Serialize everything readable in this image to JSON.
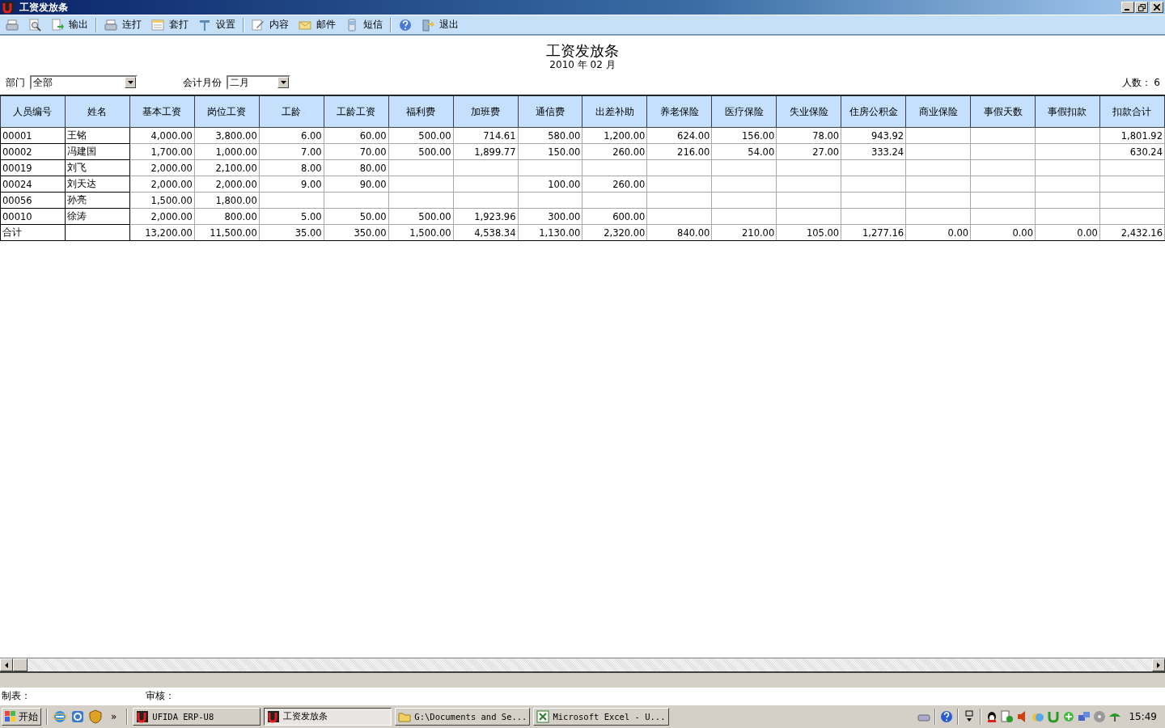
{
  "window": {
    "title": "工资发放条"
  },
  "toolbar": [
    {
      "kind": "button"
    },
    {
      "kind": "button"
    },
    {
      "kind": "button",
      "label": "输出"
    },
    {
      "kind": "separator"
    },
    {
      "kind": "button",
      "label": "连打"
    },
    {
      "kind": "button",
      "label": "套打"
    },
    {
      "kind": "button",
      "label": "设置"
    },
    {
      "kind": "separator"
    },
    {
      "kind": "button",
      "label": "内容"
    },
    {
      "kind": "button",
      "label": "邮件"
    },
    {
      "kind": "button",
      "label": "短信"
    },
    {
      "kind": "separator"
    },
    {
      "kind": "button"
    },
    {
      "kind": "button",
      "label": "退出"
    }
  ],
  "report": {
    "title": "工资发放条",
    "subtitle": "2010 年 02 月"
  },
  "filters": [
    {
      "label": "部门",
      "value": "全部"
    },
    {
      "label": "会计月份",
      "value": "二月"
    }
  ],
  "headcount": "人数： 6",
  "table": {
    "columns": [
      "人员编号",
      "姓名",
      "基本工资",
      "岗位工资",
      "工龄",
      "工龄工资",
      "福利费",
      "加班费",
      "通信费",
      "出差补助",
      "养老保险",
      "医疗保险",
      "失业保险",
      "住房公积金",
      "商业保险",
      "事假天数",
      "事假扣款",
      "扣款合计"
    ],
    "rows": [
      {
        "cells": [
          "00001",
          "王铭",
          "4,000.00",
          "3,800.00",
          "6.00",
          "60.00",
          "500.00",
          "714.61",
          "580.00",
          "1,200.00",
          "624.00",
          "156.00",
          "78.00",
          "943.92",
          null,
          null,
          null,
          "1,801.92"
        ]
      },
      {
        "cells": [
          "00002",
          "冯建国",
          "1,700.00",
          "1,000.00",
          "7.00",
          "70.00",
          "500.00",
          "1,899.77",
          "150.00",
          "260.00",
          "216.00",
          "54.00",
          "27.00",
          "333.24",
          null,
          null,
          null,
          "630.24"
        ]
      },
      {
        "cells": [
          "00019",
          "刘飞",
          "2,000.00",
          "2,100.00",
          "8.00",
          "80.00",
          null,
          null,
          null,
          null,
          null,
          null,
          null,
          null,
          null,
          null,
          null,
          null
        ]
      },
      {
        "cells": [
          "00024",
          "刘天达",
          "2,000.00",
          "2,000.00",
          "9.00",
          "90.00",
          null,
          null,
          "100.00",
          "260.00",
          null,
          null,
          null,
          null,
          null,
          null,
          null,
          null
        ]
      },
      {
        "cells": [
          "00056",
          "孙亮",
          "1,500.00",
          "1,800.00",
          null,
          null,
          null,
          null,
          null,
          null,
          null,
          null,
          null,
          null,
          null,
          null,
          null,
          null
        ]
      },
      {
        "cells": [
          "00010",
          "徐涛",
          "2,000.00",
          "800.00",
          "5.00",
          "50.00",
          "500.00",
          "1,923.96",
          "300.00",
          "600.00",
          null,
          null,
          null,
          null,
          null,
          null,
          null,
          null
        ]
      },
      {
        "cells": [
          "合计",
          null,
          "13,200.00",
          "11,500.00",
          "35.00",
          "350.00",
          "1,500.00",
          "4,538.34",
          "1,130.00",
          "2,320.00",
          "840.00",
          "210.00",
          "105.00",
          "1,277.16",
          "0.00",
          "0.00",
          "0.00",
          "2,432.16"
        ]
      }
    ]
  },
  "signatures": [
    "制表：",
    "审核："
  ],
  "taskbar": {
    "start": "开始",
    "more": "»",
    "tasks": [
      {
        "label": "UFIDA ERP-U8",
        "selected": false
      },
      {
        "label": "工资发放条",
        "selected": true
      },
      {
        "label": "G:\\Documents and Se...",
        "selected": false
      },
      {
        "label": "Microsoft Excel - U...",
        "selected": false
      }
    ],
    "time": "15:49"
  }
}
